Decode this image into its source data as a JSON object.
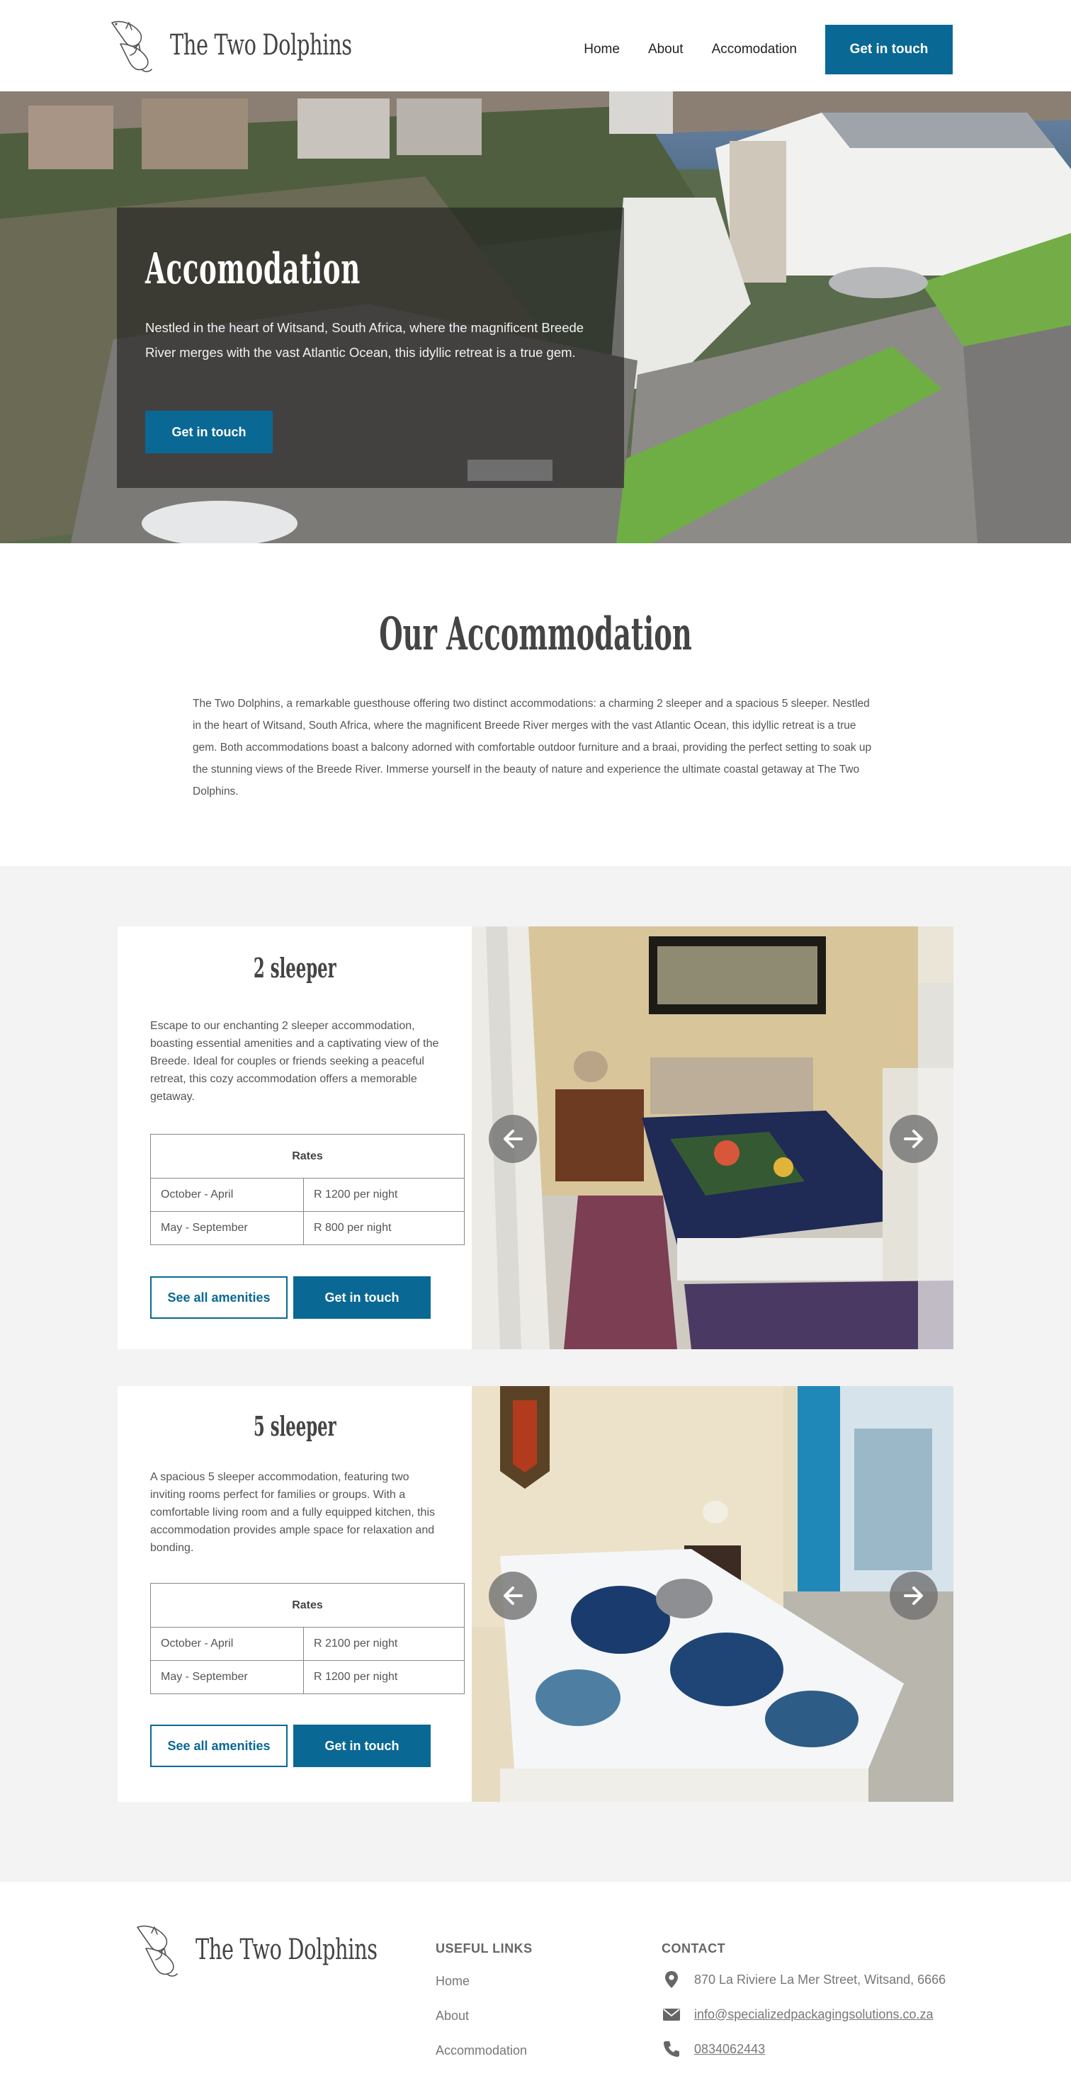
{
  "header": {
    "logo_text": "The Two Dolphins",
    "nav": [
      "Home",
      "About",
      "Accomodation"
    ],
    "cta": "Get in touch"
  },
  "hero": {
    "title": "Accomodation",
    "text": "Nestled in the heart of Witsand, South Africa, where the magnificent Breede River merges with the vast Atlantic Ocean, this idyllic retreat is a true gem.",
    "button": "Get in touch"
  },
  "intro": {
    "title": "Our Accommodation",
    "text": "The Two Dolphins, a remarkable guesthouse offering two distinct accommodations: a charming 2 sleeper and a spacious 5 sleeper. Nestled in the heart of Witsand, South Africa, where the magnificent Breede River merges with the vast Atlantic Ocean, this idyllic retreat is a true gem. Both accommodations boast a balcony adorned with comfortable outdoor furniture and a braai, providing the perfect setting to soak up the stunning views of the Breede River. Immerse yourself in the beauty of nature and experience the ultimate coastal getaway at The Two Dolphins."
  },
  "units": [
    {
      "title": "2 sleeper",
      "description": "Escape to our enchanting 2 sleeper accommodation, boasting essential amenities and a captivating view of the Breede. Ideal for couples or friends seeking a peaceful retreat, this cozy accommodation offers a memorable getaway.",
      "rates_header": "Rates",
      "rates": [
        {
          "period": "October - April",
          "price": "R 1200 per night"
        },
        {
          "period": "May - September",
          "price": "R 800 per night"
        }
      ],
      "amenities_button": "See all amenities",
      "contact_button": "Get in touch"
    },
    {
      "title": "5 sleeper",
      "description": "A spacious 5 sleeper accommodation, featuring two inviting rooms perfect for families or groups. With a comfortable living room and a fully equipped kitchen, this accommodation provides ample space for relaxation and bonding.",
      "rates_header": "Rates",
      "rates": [
        {
          "period": "October - April",
          "price": "R 2100 per night"
        },
        {
          "period": "May - September",
          "price": "R 1200 per night"
        }
      ],
      "amenities_button": "See all amenities",
      "contact_button": "Get in touch"
    }
  ],
  "footer": {
    "logo_text": "The Two Dolphins",
    "links_title": "USEFUL LINKS",
    "links": [
      "Home",
      "About",
      "Accommodation"
    ],
    "contact_title": "CONTACT",
    "address": "870 La Riviere La Mer Street, Witsand, 6666",
    "email": "info@specializedpackagingsolutions.co.za",
    "phone": "0834062443"
  },
  "colors": {
    "brand": "#0a6894",
    "section_bg": "#f3f3f3",
    "hero_overlay": "rgba(30,30,30,0.62)"
  },
  "icons": [
    "dolphin-logo-icon",
    "arrow-left-icon",
    "arrow-right-icon",
    "location-pin-icon",
    "envelope-icon",
    "phone-icon"
  ]
}
